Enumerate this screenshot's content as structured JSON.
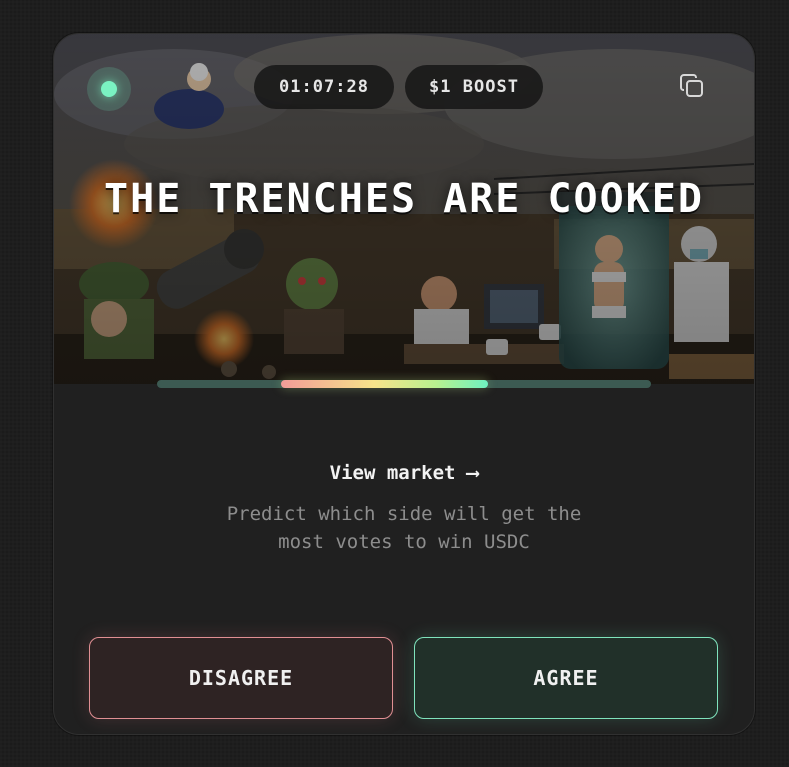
{
  "market": {
    "timer": "01:07:28",
    "boost": "$1 BOOST",
    "title": "THE TRENCHES ARE COOKED",
    "view_market": "View market ⟶",
    "subtitle": "Predict which side will get the most votes to win USDC",
    "vote_progress": 0.42,
    "disagree_label": "DISAGREE",
    "agree_label": "AGREE"
  },
  "icons": {
    "live": "live-status-dot",
    "copy": "copy-icon"
  },
  "colors": {
    "background": "#1b1b1b",
    "card": "#202020",
    "live_dot": "#7af2c2",
    "disagree_border": "#e08f93",
    "agree_border": "#7fe3bd",
    "progress_track": "#3c5a52"
  }
}
